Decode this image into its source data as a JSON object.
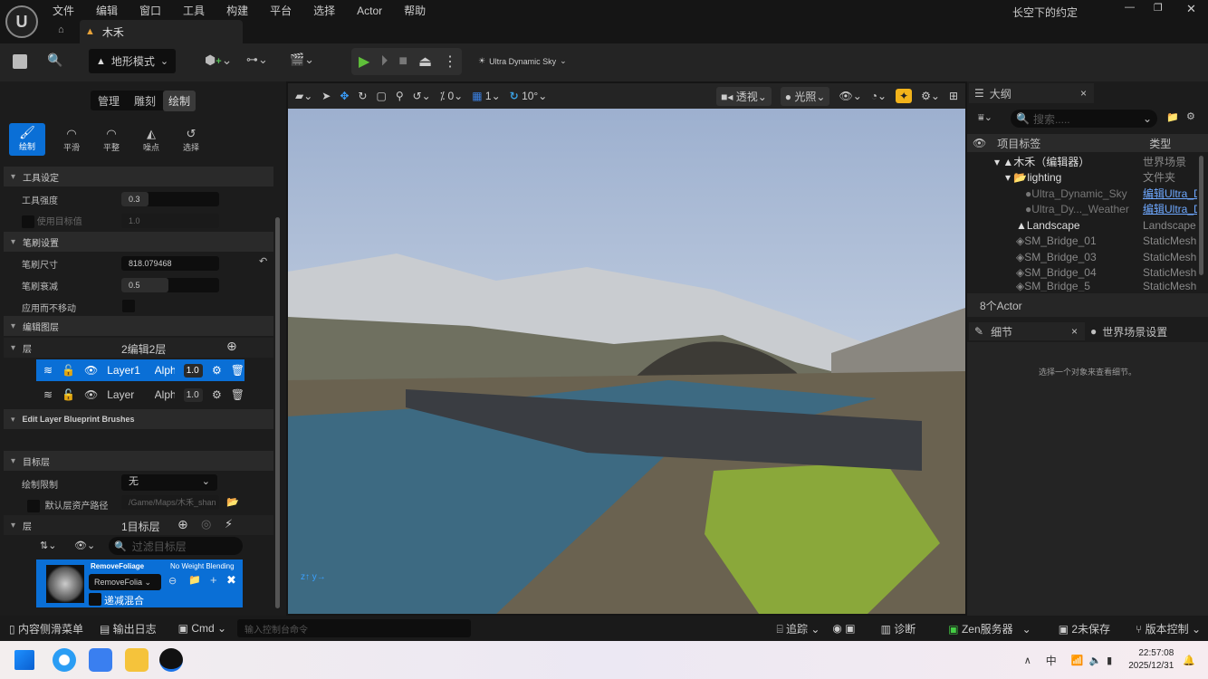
{
  "menu": [
    "文件",
    "编辑",
    "窗口",
    "工具",
    "构建",
    "平台",
    "选择",
    "Actor",
    "帮助"
  ],
  "project_title": "长空下的约定",
  "tab": {
    "label": "木禾"
  },
  "toolbar": {
    "mode": "地形模式",
    "sky": "Ultra Dynamic Sky"
  },
  "left": {
    "tabs": [
      "管理",
      "雕刻",
      "绘制"
    ],
    "tools": [
      "绘制",
      "平滑",
      "平整",
      "噪点",
      "选择"
    ],
    "sections": {
      "tool": "工具设定",
      "brush": "笔刷设置",
      "edit_layers": "编辑图层",
      "blueprint": "Edit Layer Blueprint Brushes",
      "target": "目标层"
    },
    "props": {
      "strength_label": "工具强度",
      "strength": "0.3",
      "strength_fraction": 0.3,
      "use_target_label": "使用目标值",
      "use_target": "1.0",
      "brush_size_label": "笔刷尺寸",
      "brush_size": "818.079468",
      "falloff_label": "笔刷衰减",
      "falloff": "0.5",
      "falloff_fraction": 0.5,
      "no_move_label": "应用而不移动"
    },
    "layers_label": "层",
    "layers_count": "2编辑2层",
    "layers": [
      {
        "name": "Layer1",
        "alpha_label": "Alpha",
        "alpha": "1.0"
      },
      {
        "name": "Layer",
        "alpha_label": "Alpha",
        "alpha": "1.0"
      }
    ],
    "paint_limit_label": "绘制限制",
    "paint_limit": "无",
    "asset_path_label": "默认层资产路径",
    "asset_path": "/Game/Maps/木禾_shan",
    "target_layers_label": "层",
    "target_count": "1目标层",
    "filter_placeholder": "过滤目标层",
    "target_layer": {
      "name": "RemoveFoliage",
      "blend": "No Weight Blending",
      "select": "RemoveFolia",
      "falloff_label": "递减混合"
    }
  },
  "viewport": {
    "snap_translate": "0",
    "snap_grid": "1",
    "snap_rotate": "10°",
    "view": "透视",
    "lighting": "光照"
  },
  "outliner": {
    "title": "大纲",
    "search_placeholder": "搜索.....",
    "col_label": "项目标签",
    "col_type": "类型",
    "rows": [
      {
        "label": "木禾（编辑器）",
        "type": "世界场景"
      },
      {
        "label": "lighting",
        "type": "文件夹"
      },
      {
        "label": "Ultra_Dynamic_Sky",
        "type": "编辑Ultra_D"
      },
      {
        "label": "Ultra_Dy..._Weather",
        "type": "编辑Ultra_D"
      },
      {
        "label": "Landscape",
        "type": "Landscape"
      },
      {
        "label": "SM_Bridge_01",
        "type": "StaticMesh"
      },
      {
        "label": "SM_Bridge_03",
        "type": "StaticMesh"
      },
      {
        "label": "SM_Bridge_04",
        "type": "StaticMesh"
      },
      {
        "label": "SM_Bridge_5",
        "type": "StaticMesh"
      }
    ],
    "count": "8个Actor"
  },
  "details": {
    "title": "细节",
    "world_settings": "世界场景设置",
    "empty": "选择一个对象来查看细节。"
  },
  "status": {
    "content_drawer": "内容侧滑菜单",
    "output_log": "输出日志",
    "cmd": "Cmd",
    "cmd_placeholder": "输入控制台命令",
    "trace": "追踪",
    "diag": "诊断",
    "zen": "Zen服务器",
    "unsaved": "2未保存",
    "vcs": "版本控制"
  },
  "taskbar": {
    "ime": "中",
    "time": "22:57:08",
    "date": "2025/12/31"
  }
}
